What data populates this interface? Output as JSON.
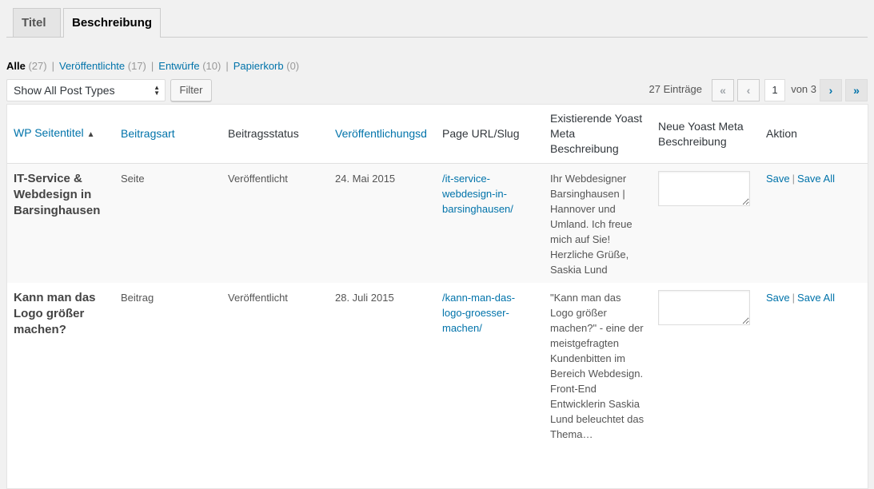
{
  "tabs": [
    {
      "label": "Titel",
      "active": false
    },
    {
      "label": "Beschreibung",
      "active": true
    }
  ],
  "views": [
    {
      "label": "Alle",
      "count": "(27)",
      "current": true
    },
    {
      "label": "Veröffentlichte",
      "count": "(17)",
      "current": false
    },
    {
      "label": "Entwürfe",
      "count": "(10)",
      "current": false
    },
    {
      "label": "Papierkorb",
      "count": "(0)",
      "current": false
    }
  ],
  "filter": {
    "post_type_selected": "Show All Post Types",
    "filter_button": "Filter"
  },
  "pagination": {
    "entries": "27 Einträge",
    "first": "«",
    "prev": "‹",
    "current_page": "1",
    "of_text": "von 3",
    "next": "›",
    "last": "»"
  },
  "table": {
    "headers": {
      "title": "WP Seitentitel",
      "sort_indicator": "▲",
      "post_type": "Beitragsart",
      "status": "Beitragsstatus",
      "date": "Veröffentlichungsd",
      "url": "Page URL/Slug",
      "existing_meta": "Existierende Yoast Meta Beschreibung",
      "new_meta": "Neue Yoast Meta Beschreibung",
      "action": "Aktion"
    },
    "rows": [
      {
        "title": "IT-Service & Webdesign in Barsinghausen",
        "type": "Seite",
        "status": "Veröffentlicht",
        "date": "24. Mai 2015",
        "slug": "/it-service-webdesign-in-barsinghausen/",
        "existing_meta": "Ihr Webdesigner Barsinghausen | Hannover und Umland. Ich freue mich auf Sie! Herzliche Grüße, Saskia Lund",
        "new_meta": "",
        "save": "Save",
        "save_all": "Save All"
      },
      {
        "title": "Kann man das Logo größer machen?",
        "type": "Beitrag",
        "status": "Veröffentlicht",
        "date": "28. Juli 2015",
        "slug": "/kann-man-das-logo-groesser-machen/",
        "existing_meta": "\"Kann man das Logo größer machen?\" - eine der meistgefragten Kundenbitten im Bereich Webdesign. Front-End Entwicklerin Saskia Lund beleuchtet das Thema…",
        "new_meta": "",
        "save": "Save",
        "save_all": "Save All"
      }
    ]
  },
  "colors": {
    "link": "#0073aa",
    "background": "#f1f1f1",
    "alt_row": "#f9f9f9"
  }
}
